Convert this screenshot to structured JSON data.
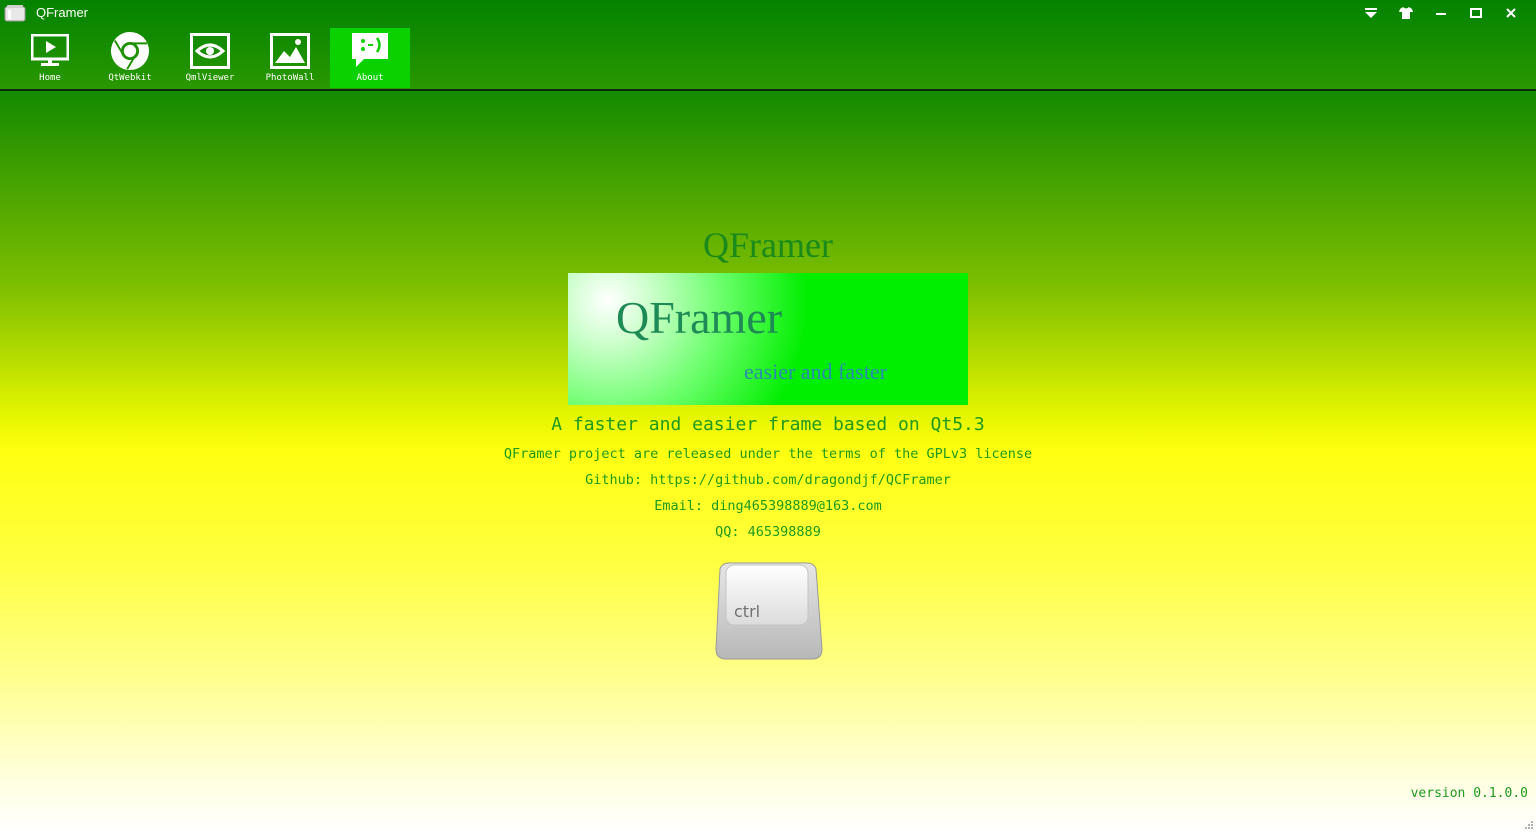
{
  "window": {
    "title": "QFramer"
  },
  "toolbar": {
    "items": [
      {
        "label": "Home",
        "icon": "monitor-play-icon",
        "active": false
      },
      {
        "label": "QtWebkit",
        "icon": "chrome-icon",
        "active": false
      },
      {
        "label": "QmlViewer",
        "icon": "eye-icon",
        "active": false
      },
      {
        "label": "PhotoWall",
        "icon": "picture-icon",
        "active": false
      },
      {
        "label": "About",
        "icon": "smiley-chat-icon",
        "active": true
      }
    ]
  },
  "window_controls": [
    "dropdown-menu-icon",
    "skin-shirt-icon",
    "minimize-icon",
    "maximize-icon",
    "close-icon"
  ],
  "about": {
    "heading": "QFramer",
    "banner_title": "QFramer",
    "banner_subtitle": "easier and faster",
    "tagline": "A faster and easier frame based on Qt5.3",
    "license": "QFramer project are released under the terms of the GPLv3 license",
    "github": "Github: https://github.com/dragondjf/QCFramer",
    "email": "Email: ding465398889@163.com",
    "qq": "QQ: 465398889",
    "key_label": "ctrl"
  },
  "footer": {
    "version": "version 0.1.0.0"
  },
  "colors": {
    "accent_green": "#0cd100",
    "text_green": "#1f9a1f",
    "bar_green": "#178e00"
  }
}
